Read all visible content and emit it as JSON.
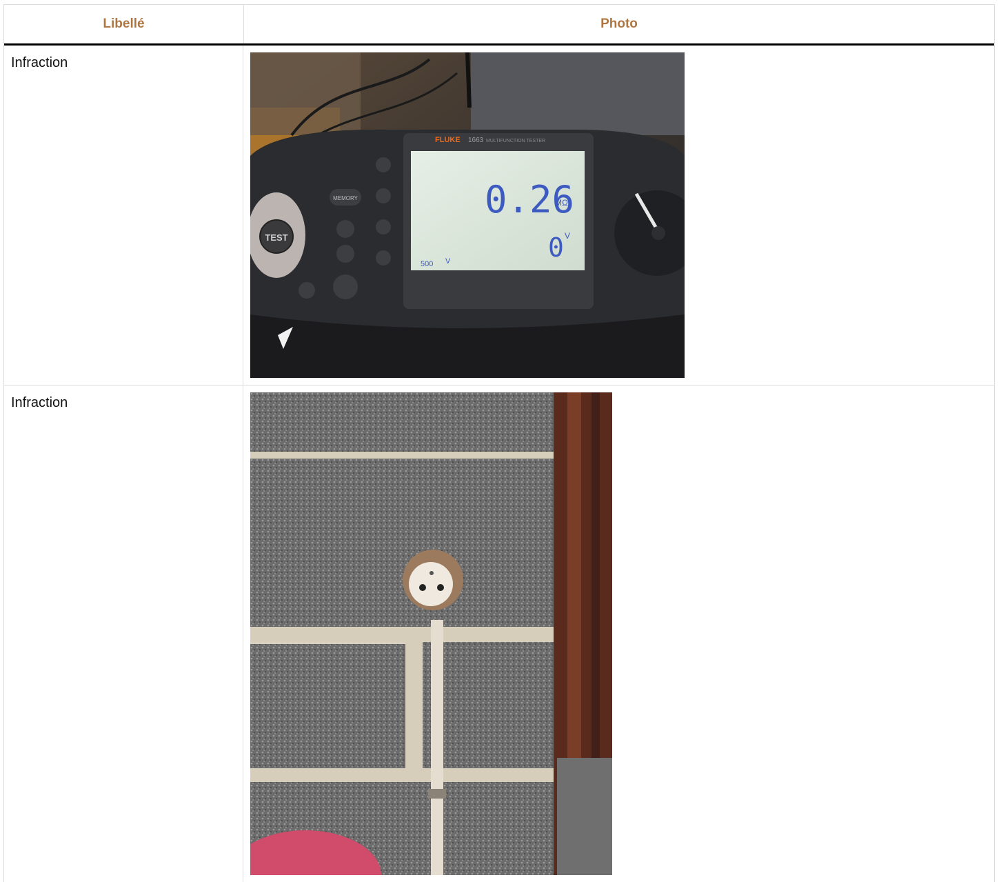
{
  "table": {
    "headers": {
      "label": "Libellé",
      "photo": "Photo"
    },
    "rows": [
      {
        "label": "Infraction",
        "photo_icon": "multifunction-tester-photo",
        "photo_text": {
          "brand": "FLUKE",
          "model": "1663",
          "model_caption": "MULTIFUNCTION TESTER",
          "reading": "0.26",
          "reading_unit": "MΩ",
          "voltage": "0",
          "voltage_unit": "V",
          "test_voltage": "500",
          "test_voltage_unit": "V",
          "button_test": "TEST",
          "button_memory": "MEMORY"
        }
      },
      {
        "label": "Infraction",
        "photo_icon": "wall-socket-photo"
      }
    ]
  }
}
